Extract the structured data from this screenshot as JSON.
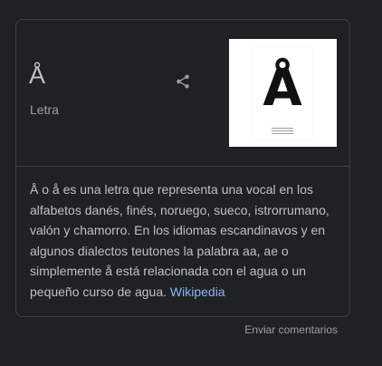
{
  "knowledge_panel": {
    "title": "Å",
    "subtitle": "Letra",
    "share_icon": "share-icon",
    "image": {
      "letter": "Å"
    },
    "description": "Å o å es una letra que representa una vocal en los alfabetos danés, finés, noruego, sueco, istrorrumano, valón y chamorro. En los idiomas escandinavos y en algunos dialectos teutones la palabra aa, ae o simplemente å está relacionada con el agua o un pequeño curso de agua.",
    "source_link": "Wikipedia"
  },
  "footer": {
    "feedback_label": "Enviar comentarios"
  },
  "colors": {
    "background": "#202124",
    "border": "#3c4043",
    "text": "#bdc1c6",
    "secondary_text": "#9aa0a6",
    "link": "#8ab4f8"
  }
}
